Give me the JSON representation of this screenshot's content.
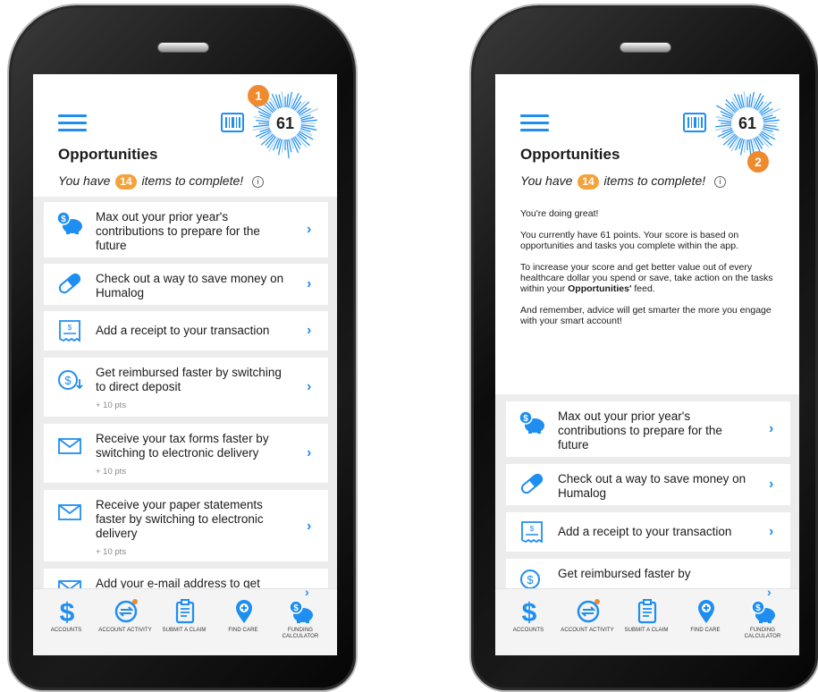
{
  "screens": [
    {
      "score": "61",
      "callout": "1",
      "title": "Opportunities",
      "subtitle_pre": "You have",
      "items_count": "14",
      "subtitle_post": "items to complete!",
      "info_glyph": "i",
      "cards": [
        {
          "icon": "piggy-bank-dollar-icon",
          "text": "Max out your prior year's contributions to prepare for the future",
          "points": ""
        },
        {
          "icon": "pill-icon",
          "text": "Check out a way to save money on Humalog",
          "points": ""
        },
        {
          "icon": "receipt-icon",
          "text": "Add a receipt to your transaction",
          "points": ""
        },
        {
          "icon": "dollar-deposit-icon",
          "text": "Get reimbursed faster by switching to direct deposit",
          "points": "+ 10 pts"
        },
        {
          "icon": "envelope-icon",
          "text": "Receive your tax forms faster by switching to electronic delivery",
          "points": "+ 10 pts"
        },
        {
          "icon": "envelope-icon",
          "text": "Receive your paper statements faster by switching to electronic delivery",
          "points": "+ 10 pts"
        },
        {
          "icon": "envelope-icon",
          "text": "Add your e-mail address to get",
          "points": ""
        }
      ]
    },
    {
      "score": "61",
      "callout": "2",
      "title": "Opportunities",
      "subtitle_pre": "You have",
      "items_count": "14",
      "subtitle_post": "items to complete!",
      "info_glyph": "i",
      "detail": {
        "p1": "You're doing great!",
        "p2": "You currently have 61 points. Your score is based on opportunities and tasks you complete within the app.",
        "p3_pre": "To increase your score and get better value out of every healthcare dollar you spend or save, take action on the tasks within your",
        "p3_bold": "Opportunities'",
        "p3_post": "feed.",
        "p4": "And remember, advice will get smarter the more you engage with your smart account!"
      },
      "cards": [
        {
          "icon": "piggy-bank-dollar-icon",
          "text": "Max out your prior year's contributions to prepare for the future",
          "points": ""
        },
        {
          "icon": "pill-icon",
          "text": "Check out a way to save money on Humalog",
          "points": ""
        },
        {
          "icon": "receipt-icon",
          "text": "Add a receipt to your transaction",
          "points": ""
        },
        {
          "icon": "dollar-deposit-icon",
          "text": "Get reimbursed faster by",
          "points": ""
        }
      ]
    }
  ],
  "tabs": [
    {
      "icon": "dollar-sign-icon",
      "label": "ACCOUNTS"
    },
    {
      "icon": "account-activity-icon",
      "label": "ACCOUNT ACTIVITY"
    },
    {
      "icon": "clipboard-icon",
      "label": "SUBMIT A CLAIM"
    },
    {
      "icon": "map-pin-plus-icon",
      "label": "FIND CARE"
    },
    {
      "icon": "piggy-bank-dollar-icon",
      "label": "FUNDING CALCULATOR"
    }
  ],
  "colors": {
    "accent": "#1e8ef0",
    "badge": "#f3a33a",
    "callout": "#ef8a2e"
  }
}
